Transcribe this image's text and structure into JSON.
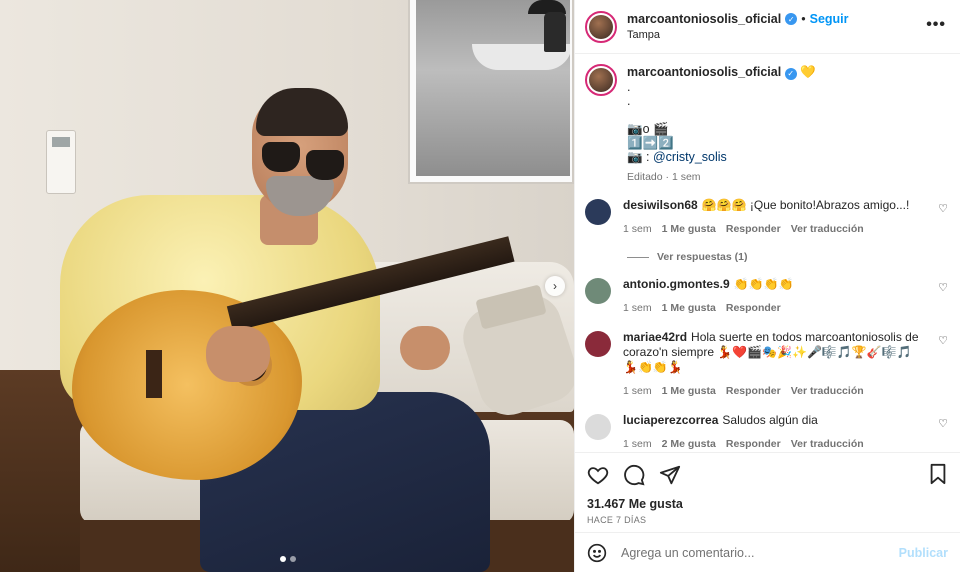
{
  "header": {
    "username": "marcoantoniosolis_oficial",
    "separator": "•",
    "follow_label": "Seguir",
    "location": "Tampa",
    "more_icon": "more-horizontal-icon"
  },
  "caption": {
    "username": "marcoantoniosolis_oficial",
    "emoji": "💛",
    "lines": [
      ".",
      ".",
      "",
      "📷o 🎬",
      "1️⃣➡️2️⃣"
    ],
    "credit_prefix": "📷 : ",
    "credit_mention": "@cristy_solis",
    "meta": "Editado · 1 sem"
  },
  "comments": [
    {
      "username": "desiwilson68",
      "text": "🤗🤗🤗 ¡Que bonito!Abrazos amigo...!",
      "time": "1 sem",
      "likes": "1 Me gusta",
      "reply": "Responder",
      "translate": "Ver traducción",
      "avatar_color": "#2b3a5a"
    },
    {
      "username": "antonio.gmontes.9",
      "text": "👏👏👏👏",
      "time": "1 sem",
      "likes": "1 Me gusta",
      "reply": "Responder",
      "translate": "",
      "avatar_color": "#6f8a78"
    },
    {
      "username": "mariae42rd",
      "text": "Hola suerte en todos marcoantoniosolis de corazo'n siempre 💃❤️🎬🎭🎉✨🎤🎼🎵🏆🎸🎼🎵💃👏👏💃",
      "time": "1 sem",
      "likes": "1 Me gusta",
      "reply": "Responder",
      "translate": "Ver traducción",
      "avatar_color": "#8a2a3a"
    },
    {
      "username": "luciaperezcorrea",
      "text": "Saludos algún dia",
      "time": "1 sem",
      "likes": "2 Me gusta",
      "reply": "Responder",
      "translate": "Ver traducción",
      "avatar_color": "#dbdbdb"
    }
  ],
  "replies_label": "Ver respuestas (1)",
  "actions": {
    "likes": "31.467 Me gusta",
    "date": "HACE 7 DÍAS"
  },
  "add_comment": {
    "placeholder": "Agrega un comentario...",
    "publish": "Publicar"
  },
  "carousel": {
    "current": 1,
    "total": 2
  },
  "colors": {
    "accent": "#0095f6",
    "verified": "#3897f0",
    "publish_disabled": "#b2dffc"
  }
}
